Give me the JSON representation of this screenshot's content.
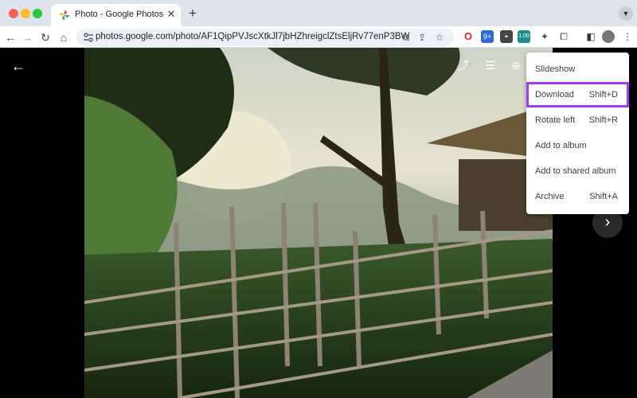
{
  "browser": {
    "tab_title": "Photo - Google Photos",
    "tab_close": "✕",
    "new_tab": "+",
    "url": "photos.google.com/photo/AF1QipPVJscXtkJl7jbHZhreigclZtsEljRv77enP3BW",
    "extension_badge": "9+",
    "extension_label": "1.00"
  },
  "menu": {
    "items": [
      {
        "label": "Slideshow",
        "shortcut": ""
      },
      {
        "label": "Download",
        "shortcut": "Shift+D"
      },
      {
        "label": "Rotate left",
        "shortcut": "Shift+R"
      },
      {
        "label": "Add to album",
        "shortcut": ""
      },
      {
        "label": "Add to shared album",
        "shortcut": ""
      },
      {
        "label": "Archive",
        "shortcut": "Shift+A"
      }
    ],
    "highlight_color": "#a23cf2"
  }
}
